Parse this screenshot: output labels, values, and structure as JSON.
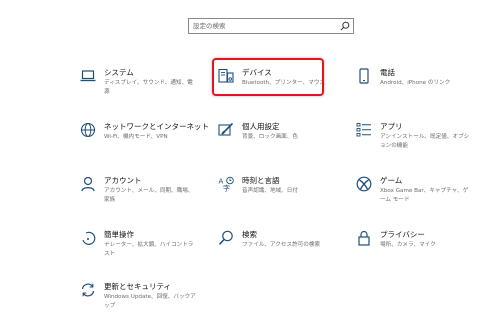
{
  "search": {
    "placeholder": "設定の検索"
  },
  "tiles": [
    {
      "title": "システム",
      "desc": "ディスプレイ、サウンド、通知、電源",
      "icon": "laptop-icon"
    },
    {
      "title": "デバイス",
      "desc": "Bluetooth、プリンター、マウス",
      "icon": "keyboard-speaker-icon"
    },
    {
      "title": "電話",
      "desc": "Android、iPhone のリンク",
      "icon": "phone-icon"
    },
    {
      "title": "ネットワークとインターネット",
      "desc": "Wi-Fi、機内モード、VPN",
      "icon": "globe-icon"
    },
    {
      "title": "個人用設定",
      "desc": "背景、ロック画面、色",
      "icon": "paint-icon"
    },
    {
      "title": "アプリ",
      "desc": "アンインストール、既定値、オプションの機能",
      "icon": "app-list-icon"
    },
    {
      "title": "アカウント",
      "desc": "アカウント、メール、同期、職場、家族",
      "icon": "person-icon"
    },
    {
      "title": "時刻と言語",
      "desc": "音声認識、地域、日付",
      "icon": "time-language-icon"
    },
    {
      "title": "ゲーム",
      "desc": "Xbox Game Bar、キャプチャ、ゲーム モード",
      "icon": "xbox-icon"
    },
    {
      "title": "簡単操作",
      "desc": "ナレーター、拡大鏡、ハイコントラスト",
      "icon": "ease-of-access-icon"
    },
    {
      "title": "検索",
      "desc": "ファイル、アクセス許可の検索",
      "icon": "search-icon"
    },
    {
      "title": "プライバシー",
      "desc": "場所、カメラ、マイク",
      "icon": "lock-icon"
    },
    {
      "title": "更新とセキュリティ",
      "desc": "Windows Update、回復、バックアップ",
      "icon": "sync-icon"
    }
  ],
  "colors": {
    "accent": "#1f4e79",
    "highlight": "#e3141b"
  }
}
